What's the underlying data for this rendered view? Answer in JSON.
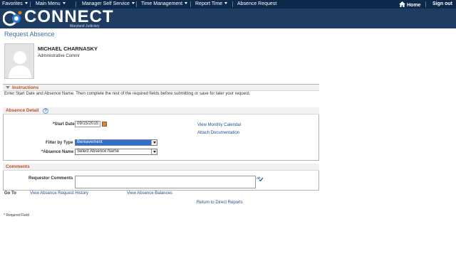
{
  "nav": {
    "favorites": "Favorites",
    "main_menu": "Main Menu",
    "manager_self_service": "Manager Self Service",
    "time_management": "Time Management",
    "report_time": "Report Time",
    "absence_request": "Absence Request",
    "home": "Home",
    "sign_out": "Sign out"
  },
  "brand": {
    "name": "CONNECT",
    "sub": "Maryland Judiciary"
  },
  "page": {
    "title": "Request Absence"
  },
  "employee": {
    "name": "MICHAEL CHARNASKY",
    "title": "Administrative Commr"
  },
  "instructions": {
    "header": "Instructions",
    "text": "Enter Start Date and Absence Name. Then complete the rest of the required fields before submitting or save for later your request."
  },
  "absence_detail": {
    "header": "Absence Detail",
    "start_date_label": "*Start Date",
    "start_date_value": "09/15/2015",
    "filter_label": "Filter by Type",
    "filter_value": "Bereavement",
    "absence_name_label": "*Absence Name",
    "absence_name_value": "Select Absence Name",
    "view_monthly_calendar": "View Monthly Calendar",
    "attach_documentation": "Attach Documentation"
  },
  "comments": {
    "header": "Comments",
    "requestor_label": "Requestor Comments"
  },
  "goto": {
    "label": "Go To",
    "history_link": "View Absence Request History",
    "balances_link": "View Absence Balances",
    "return_link": "Return to Direct Reports"
  },
  "footer": {
    "required_note": "* Required Field"
  },
  "colors": {
    "nav_bg": "#0d2a4c",
    "banner_bg": "#1f3d63",
    "section_title": "#b5512a",
    "link": "#1e4f8f",
    "selected": "#2e6fd0"
  }
}
